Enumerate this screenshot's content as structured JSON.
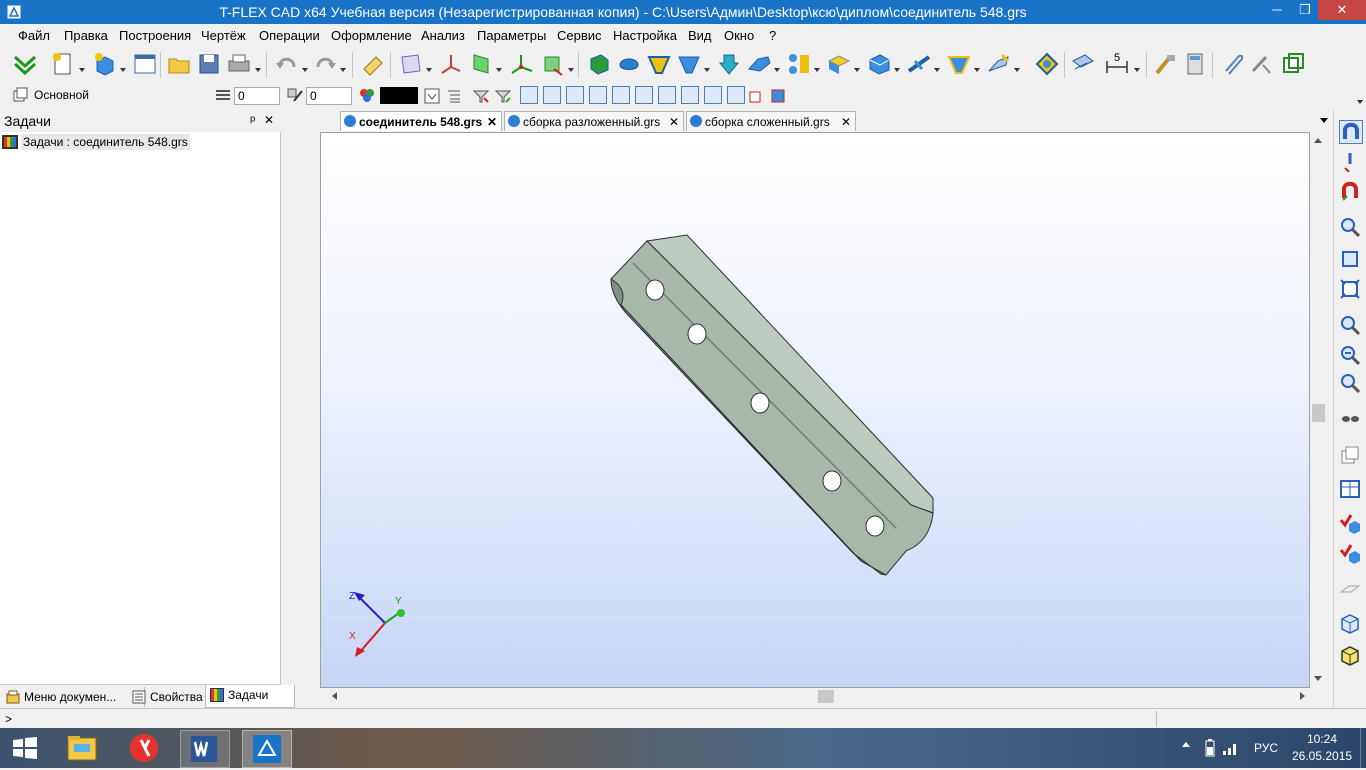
{
  "window": {
    "title": "T-FLEX CAD x64 Учебная версия (Незарегистрированная копия) - C:\\Users\\Админ\\Desktop\\ксю\\диплом\\соединитель 548.grs",
    "minimize_glyph": "─",
    "restore_glyph": "❐",
    "close_glyph": "✕"
  },
  "menu": [
    "Файл",
    "Правка",
    "Построения",
    "Чертёж",
    "Операции",
    "Оформление",
    "Анализ",
    "Параметры",
    "Сервис",
    "Настройка",
    "Вид",
    "Окно",
    "?"
  ],
  "toolbar2": {
    "layer_name": "Основной",
    "level_value": "0",
    "priority_value": "0",
    "color_value": "#000000"
  },
  "toolbar1": {
    "dimension_digit": "5"
  },
  "tasks_panel": {
    "title": "Задачи",
    "pin_glyph": "ᵖ",
    "close_glyph": "✕",
    "item_label": "Задачи : соединитель 548.grs"
  },
  "bottom_tabs": [
    "Меню докумен...",
    "Свойства",
    "Задачи"
  ],
  "doc_tabs": [
    {
      "label": "соединитель 548.grs",
      "active": true
    },
    {
      "label": "сборка разложенный.grs",
      "active": false
    },
    {
      "label": "сборка сложенный.grs",
      "active": false
    }
  ],
  "doc_tab_close": "✕",
  "axes": {
    "x": "X",
    "y": "Y",
    "z": "Z"
  },
  "status": {
    "prompt": ">"
  },
  "taskbar": {
    "time": "10:24",
    "date": "26.05.2015",
    "language": "РУС"
  },
  "colors": {
    "titlebar": "#1973c7",
    "part_face": "#a7b8ab",
    "part_top": "#bccabf",
    "part_dark": "#7f9183",
    "close_button": "#c74646"
  }
}
